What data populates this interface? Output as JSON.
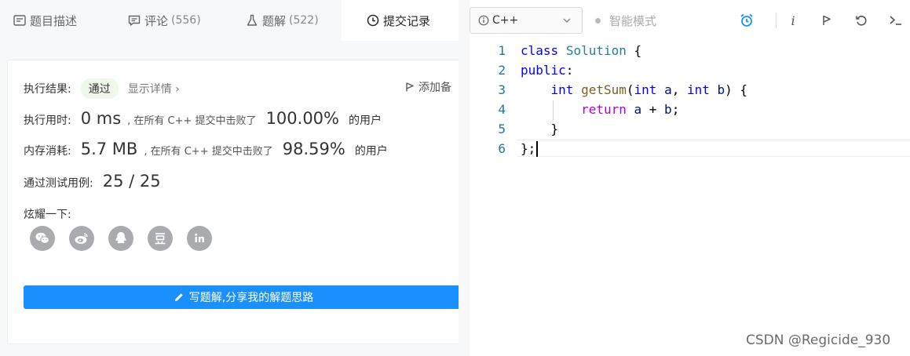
{
  "tabs": [
    {
      "label": "题目描述",
      "count": ""
    },
    {
      "label": "评论",
      "count": "(556)"
    },
    {
      "label": "题解",
      "count": "(522)"
    },
    {
      "label": "提交记录",
      "count": ""
    }
  ],
  "result": {
    "label": "执行结果:",
    "status": "通过",
    "details_link": "显示详情",
    "add_note": "添加备"
  },
  "runtime": {
    "label": "执行用时:",
    "value": "0 ms",
    "mid": ", 在所有 C++ 提交中击败了",
    "percent": "100.00%",
    "suffix": "的用户"
  },
  "memory": {
    "label": "内存消耗:",
    "value": "5.7 MB",
    "mid": ", 在所有 C++ 提交中击败了",
    "percent": "98.59%",
    "suffix": "的用户"
  },
  "testcases": {
    "label": "通过测试用例:",
    "value": "25 / 25"
  },
  "share": {
    "label": "炫耀一下:",
    "icons": [
      "wechat-icon",
      "weibo-icon",
      "qq-icon",
      "douban-icon",
      "linkedin-icon"
    ]
  },
  "write_solution_label": "写题解,分享我的解题思路",
  "editor": {
    "language": "C++",
    "smart_mode_label": "智能模式",
    "line_numbers": [
      "1",
      "2",
      "3",
      "4",
      "5",
      "6"
    ]
  },
  "watermark": "CSDN @Regicide_930",
  "colors": {
    "accent": "#1a90ff",
    "alarm": "#1a90ff",
    "status_bg": "#f0f7eb"
  }
}
